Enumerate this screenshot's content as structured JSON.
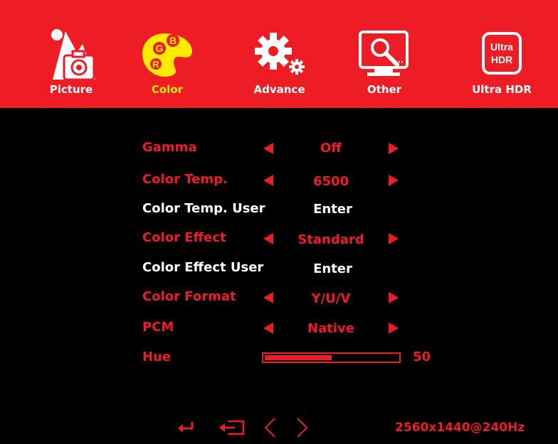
{
  "colors": {
    "accent": "#ee1c24",
    "active_tab": "#ffea00",
    "background": "#000000",
    "text": "#ffffff"
  },
  "tabs": [
    {
      "label": "Picture",
      "icon": "picture-icon",
      "active": false
    },
    {
      "label": "Color",
      "icon": "palette-icon",
      "active": true
    },
    {
      "label": "Advance",
      "icon": "gear-icon",
      "active": false
    },
    {
      "label": "Other",
      "icon": "monitor-search-icon",
      "active": false
    },
    {
      "label": "Ultra HDR",
      "icon": "ultra-hdr-icon",
      "active": false
    }
  ],
  "palette_letters": {
    "g": "G",
    "b": "B",
    "r": "R"
  },
  "ultra_hdr_badge": {
    "line1": "Ultra",
    "line2": "HDR"
  },
  "menu": [
    {
      "name": "Gamma",
      "value": "Off",
      "type": "select"
    },
    {
      "name": "Color Temp.",
      "value": "6500",
      "type": "select"
    },
    {
      "name": "Color Temp. User",
      "value": "Enter",
      "type": "enter"
    },
    {
      "name": "Color Effect",
      "value": "Standard",
      "type": "select"
    },
    {
      "name": "Color Effect User",
      "value": "Enter",
      "type": "enter"
    },
    {
      "name": "Color Format",
      "value": "Y/U/V",
      "type": "select"
    },
    {
      "name": "PCM",
      "value": "Native",
      "type": "select"
    }
  ],
  "hue": {
    "name": "Hue",
    "value": "50",
    "level": 0.5
  },
  "footer": {
    "icons": [
      "enter-icon",
      "exit-icon",
      "left-icon",
      "right-icon"
    ],
    "resolution": "2560x1440@240Hz"
  }
}
